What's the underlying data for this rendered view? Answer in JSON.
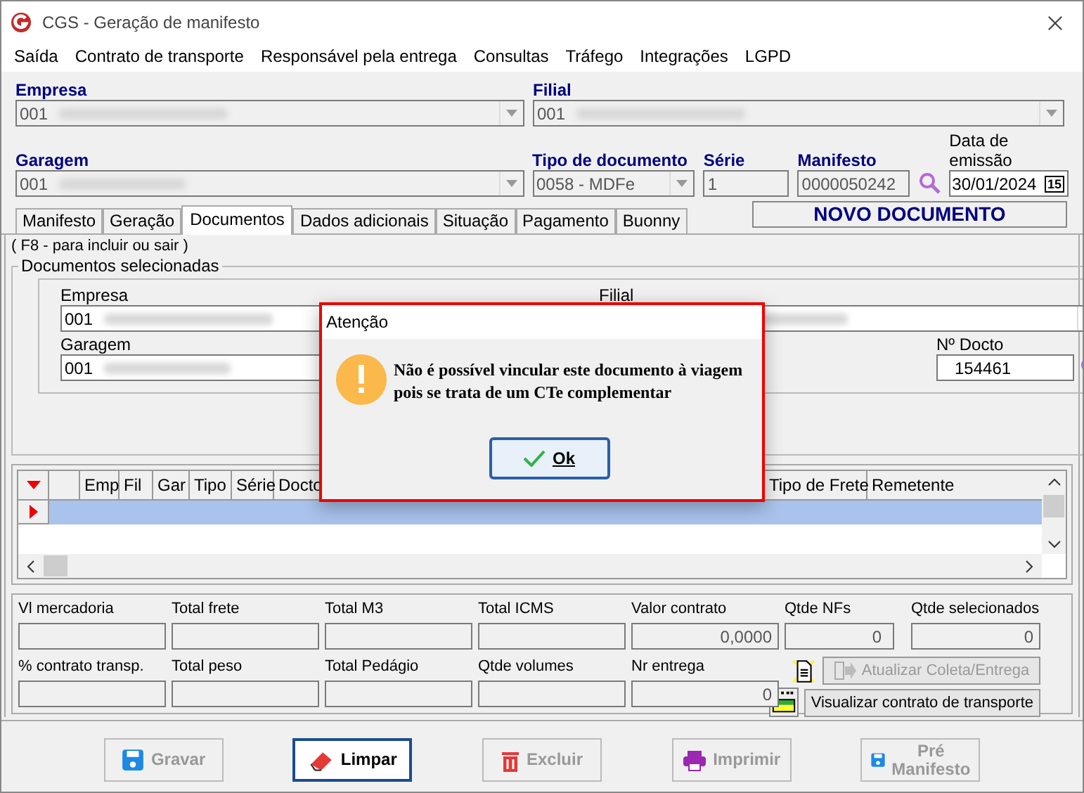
{
  "window": {
    "title": "CGS - Geração de manifesto"
  },
  "menu": [
    "Saída",
    "Contrato de transporte",
    "Responsável pela entrega",
    "Consultas",
    "Tráfego",
    "Integrações",
    "LGPD"
  ],
  "header": {
    "empresa": {
      "label": "Empresa",
      "value": "001"
    },
    "filial": {
      "label": "Filial",
      "value": "001"
    },
    "garagem": {
      "label": "Garagem",
      "value": "001"
    },
    "tipo_documento": {
      "label": "Tipo de documento",
      "value": "0058 - MDFe"
    },
    "serie": {
      "label": "Série",
      "value": "1"
    },
    "manifesto": {
      "label": "Manifesto",
      "value": "0000050242"
    },
    "data_emissao": {
      "label": "Data de emissão",
      "value": "30/01/2024",
      "calendar": "15"
    }
  },
  "tabs": [
    {
      "label": "Manifesto",
      "selected": false
    },
    {
      "label": "Geração",
      "selected": false
    },
    {
      "label": "Documentos",
      "selected": true
    },
    {
      "label": "Dados adicionais",
      "selected": false
    },
    {
      "label": "Situação",
      "selected": false
    },
    {
      "label": "Pagamento",
      "selected": false
    },
    {
      "label": "Buonny",
      "selected": false
    }
  ],
  "status_banner": "NOVO DOCUMENTO",
  "hint": "( F8 - para incluir ou sair )",
  "group": {
    "title": "Documentos selecionadas",
    "empresa": {
      "label": "Empresa",
      "value": "001"
    },
    "filial": {
      "label": "Filial"
    },
    "garagem": {
      "label": "Garagem",
      "value": "001"
    },
    "numero_docto": {
      "label": "Nº Docto",
      "value": "154461"
    }
  },
  "grid": {
    "columns": [
      "Emp",
      "Fil",
      "Gar",
      "Tipo",
      "Série",
      "Docto",
      "Tipo de Frete",
      "Remetente"
    ],
    "rows": [
      {
        "selected": true
      }
    ]
  },
  "totals": [
    {
      "label": "Vl mercadoria"
    },
    {
      "label": "Total frete"
    },
    {
      "label": "Total M3"
    },
    {
      "label": "Total ICMS"
    },
    {
      "label": "Valor contrato",
      "value": "0,0000"
    },
    {
      "label": "Qtde NFs",
      "value": "0"
    },
    {
      "label": "Qtde selecionados",
      "value": "0"
    },
    {
      "label": "% contrato transp."
    },
    {
      "label": "Total peso"
    },
    {
      "label": "Total Pedágio"
    },
    {
      "label": "Qtde volumes"
    },
    {
      "label": "Nr entrega",
      "value": "0"
    }
  ],
  "side_buttons": [
    {
      "label": "Atualizar Coleta/Entrega",
      "disabled": true
    },
    {
      "label": "Visualizar contrato de transporte",
      "disabled": false
    }
  ],
  "buttons": [
    {
      "label": "Gravar",
      "kind": "save",
      "disabled": true,
      "focused": false
    },
    {
      "label": "Limpar",
      "kind": "clear",
      "disabled": false,
      "focused": true
    },
    {
      "label": "Excluir",
      "kind": "delete",
      "disabled": true,
      "focused": false
    },
    {
      "label": "Imprimir",
      "kind": "print",
      "disabled": true,
      "focused": false
    },
    {
      "label": "Pré Manifesto",
      "kind": "save",
      "disabled": true,
      "focused": false
    }
  ],
  "dialog": {
    "title": "Atenção",
    "message": "Não é possível vincular este documento à viagem pois se trata de um CTe complementar",
    "ok": "Ok"
  }
}
